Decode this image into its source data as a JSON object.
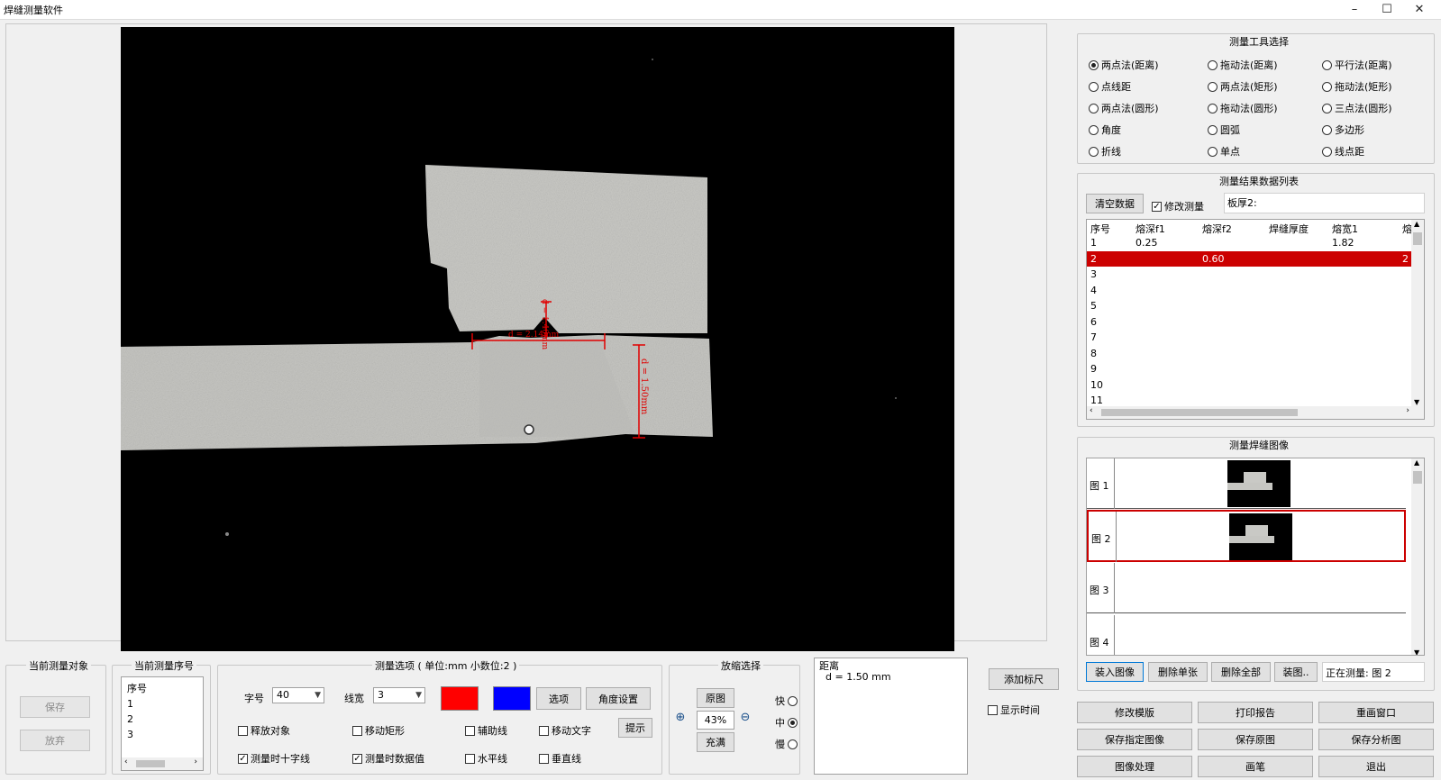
{
  "window": {
    "title": "焊缝测量软件",
    "minimize": "–",
    "maximize": "☐",
    "close": "✕"
  },
  "image": {
    "annotations": {
      "depth_label": "d = 1.40mm",
      "width_label": "d = 2.14mm",
      "distance_label": "d = 1.50mm"
    }
  },
  "tools": {
    "title": "测量工具选择",
    "options": [
      {
        "label": "两点法(距离)",
        "selected": true
      },
      {
        "label": "拖动法(距离)",
        "selected": false
      },
      {
        "label": "平行法(距离)",
        "selected": false
      },
      {
        "label": "点线距",
        "selected": false
      },
      {
        "label": "两点法(矩形)",
        "selected": false
      },
      {
        "label": "拖动法(矩形)",
        "selected": false
      },
      {
        "label": "两点法(圆形)",
        "selected": false
      },
      {
        "label": "拖动法(圆形)",
        "selected": false
      },
      {
        "label": "三点法(圆形)",
        "selected": false
      },
      {
        "label": "角度",
        "selected": false
      },
      {
        "label": "圆弧",
        "selected": false
      },
      {
        "label": "多边形",
        "selected": false
      },
      {
        "label": "折线",
        "selected": false
      },
      {
        "label": "单点",
        "selected": false
      },
      {
        "label": "线点距",
        "selected": false
      }
    ]
  },
  "results": {
    "title": "测量结果数据列表",
    "clear_button": "清空数据",
    "modify_checkbox": "修改测量",
    "modify_checked": true,
    "board_thickness_label": "板厚2:",
    "columns": [
      "序号",
      "熔深f1",
      "熔深f2",
      "焊缝厚度",
      "熔宽1",
      "熔"
    ],
    "rows": [
      [
        "1",
        "0.25",
        "",
        "",
        "1.82",
        ""
      ],
      [
        "2",
        "",
        "0.60",
        "",
        "",
        "2"
      ],
      [
        "3",
        "",
        "",
        "",
        "",
        ""
      ],
      [
        "4",
        "",
        "",
        "",
        "",
        ""
      ],
      [
        "5",
        "",
        "",
        "",
        "",
        ""
      ],
      [
        "6",
        "",
        "",
        "",
        "",
        ""
      ],
      [
        "7",
        "",
        "",
        "",
        "",
        ""
      ],
      [
        "8",
        "",
        "",
        "",
        "",
        ""
      ],
      [
        "9",
        "",
        "",
        "",
        "",
        ""
      ],
      [
        "10",
        "",
        "",
        "",
        "",
        ""
      ],
      [
        "11",
        "",
        "",
        "",
        "",
        ""
      ]
    ],
    "selected_row": 2
  },
  "images_panel": {
    "title": "测量焊缝图像",
    "items": [
      {
        "label": "图 1",
        "has_thumb": true,
        "selected": false
      },
      {
        "label": "图 2",
        "has_thumb": true,
        "selected": true
      },
      {
        "label": "图 3",
        "has_thumb": false,
        "selected": false
      },
      {
        "label": "图 4",
        "has_thumb": false,
        "selected": false
      }
    ],
    "load_button": "装入图像",
    "delete_one_button": "删除单张",
    "delete_all_button": "删除全部",
    "more_button": "装图..",
    "status": "正在测量: 图 2"
  },
  "bottom_right_buttons": [
    "修改模版",
    "打印报告",
    "重画窗口",
    "保存指定图像",
    "保存原图",
    "保存分析图",
    "图像处理",
    "画笔",
    "退出"
  ],
  "current_object": {
    "title": "当前测量对象",
    "save": "保存",
    "discard": "放弃"
  },
  "current_index": {
    "title": "当前测量序号",
    "items": [
      "序号",
      "1",
      "2",
      "3"
    ]
  },
  "options": {
    "title": "测量选项 ( 单位:mm  小数位:2 )",
    "font_label": "字号",
    "font_value": "40",
    "line_label": "线宽",
    "line_value": "3",
    "color1": "#ff0000",
    "color2": "#0000ff",
    "options_button": "选项",
    "angle_button": "角度设置",
    "hint_button": "提示",
    "checkboxes": [
      {
        "label": "释放对象",
        "checked": false
      },
      {
        "label": "移动矩形",
        "checked": false
      },
      {
        "label": "辅助线",
        "checked": false
      },
      {
        "label": "移动文字",
        "checked": false
      },
      {
        "label": "测量时十字线",
        "checked": true
      },
      {
        "label": "测量时数据值",
        "checked": true
      },
      {
        "label": "水平线",
        "checked": false
      },
      {
        "label": "垂直线",
        "checked": false
      }
    ]
  },
  "zoom": {
    "title": "放缩选择",
    "original_button": "原图",
    "value": "43%",
    "fill_button": "充满",
    "speed_fast": "快",
    "speed_mid": "中",
    "speed_slow": "慢",
    "selected_speed": "中"
  },
  "info_box": {
    "line1": "距离",
    "line2": "d = 1.50 mm"
  },
  "add_ruler_button": "添加标尺",
  "show_time_checkbox": "显示时间",
  "show_time_checked": false
}
